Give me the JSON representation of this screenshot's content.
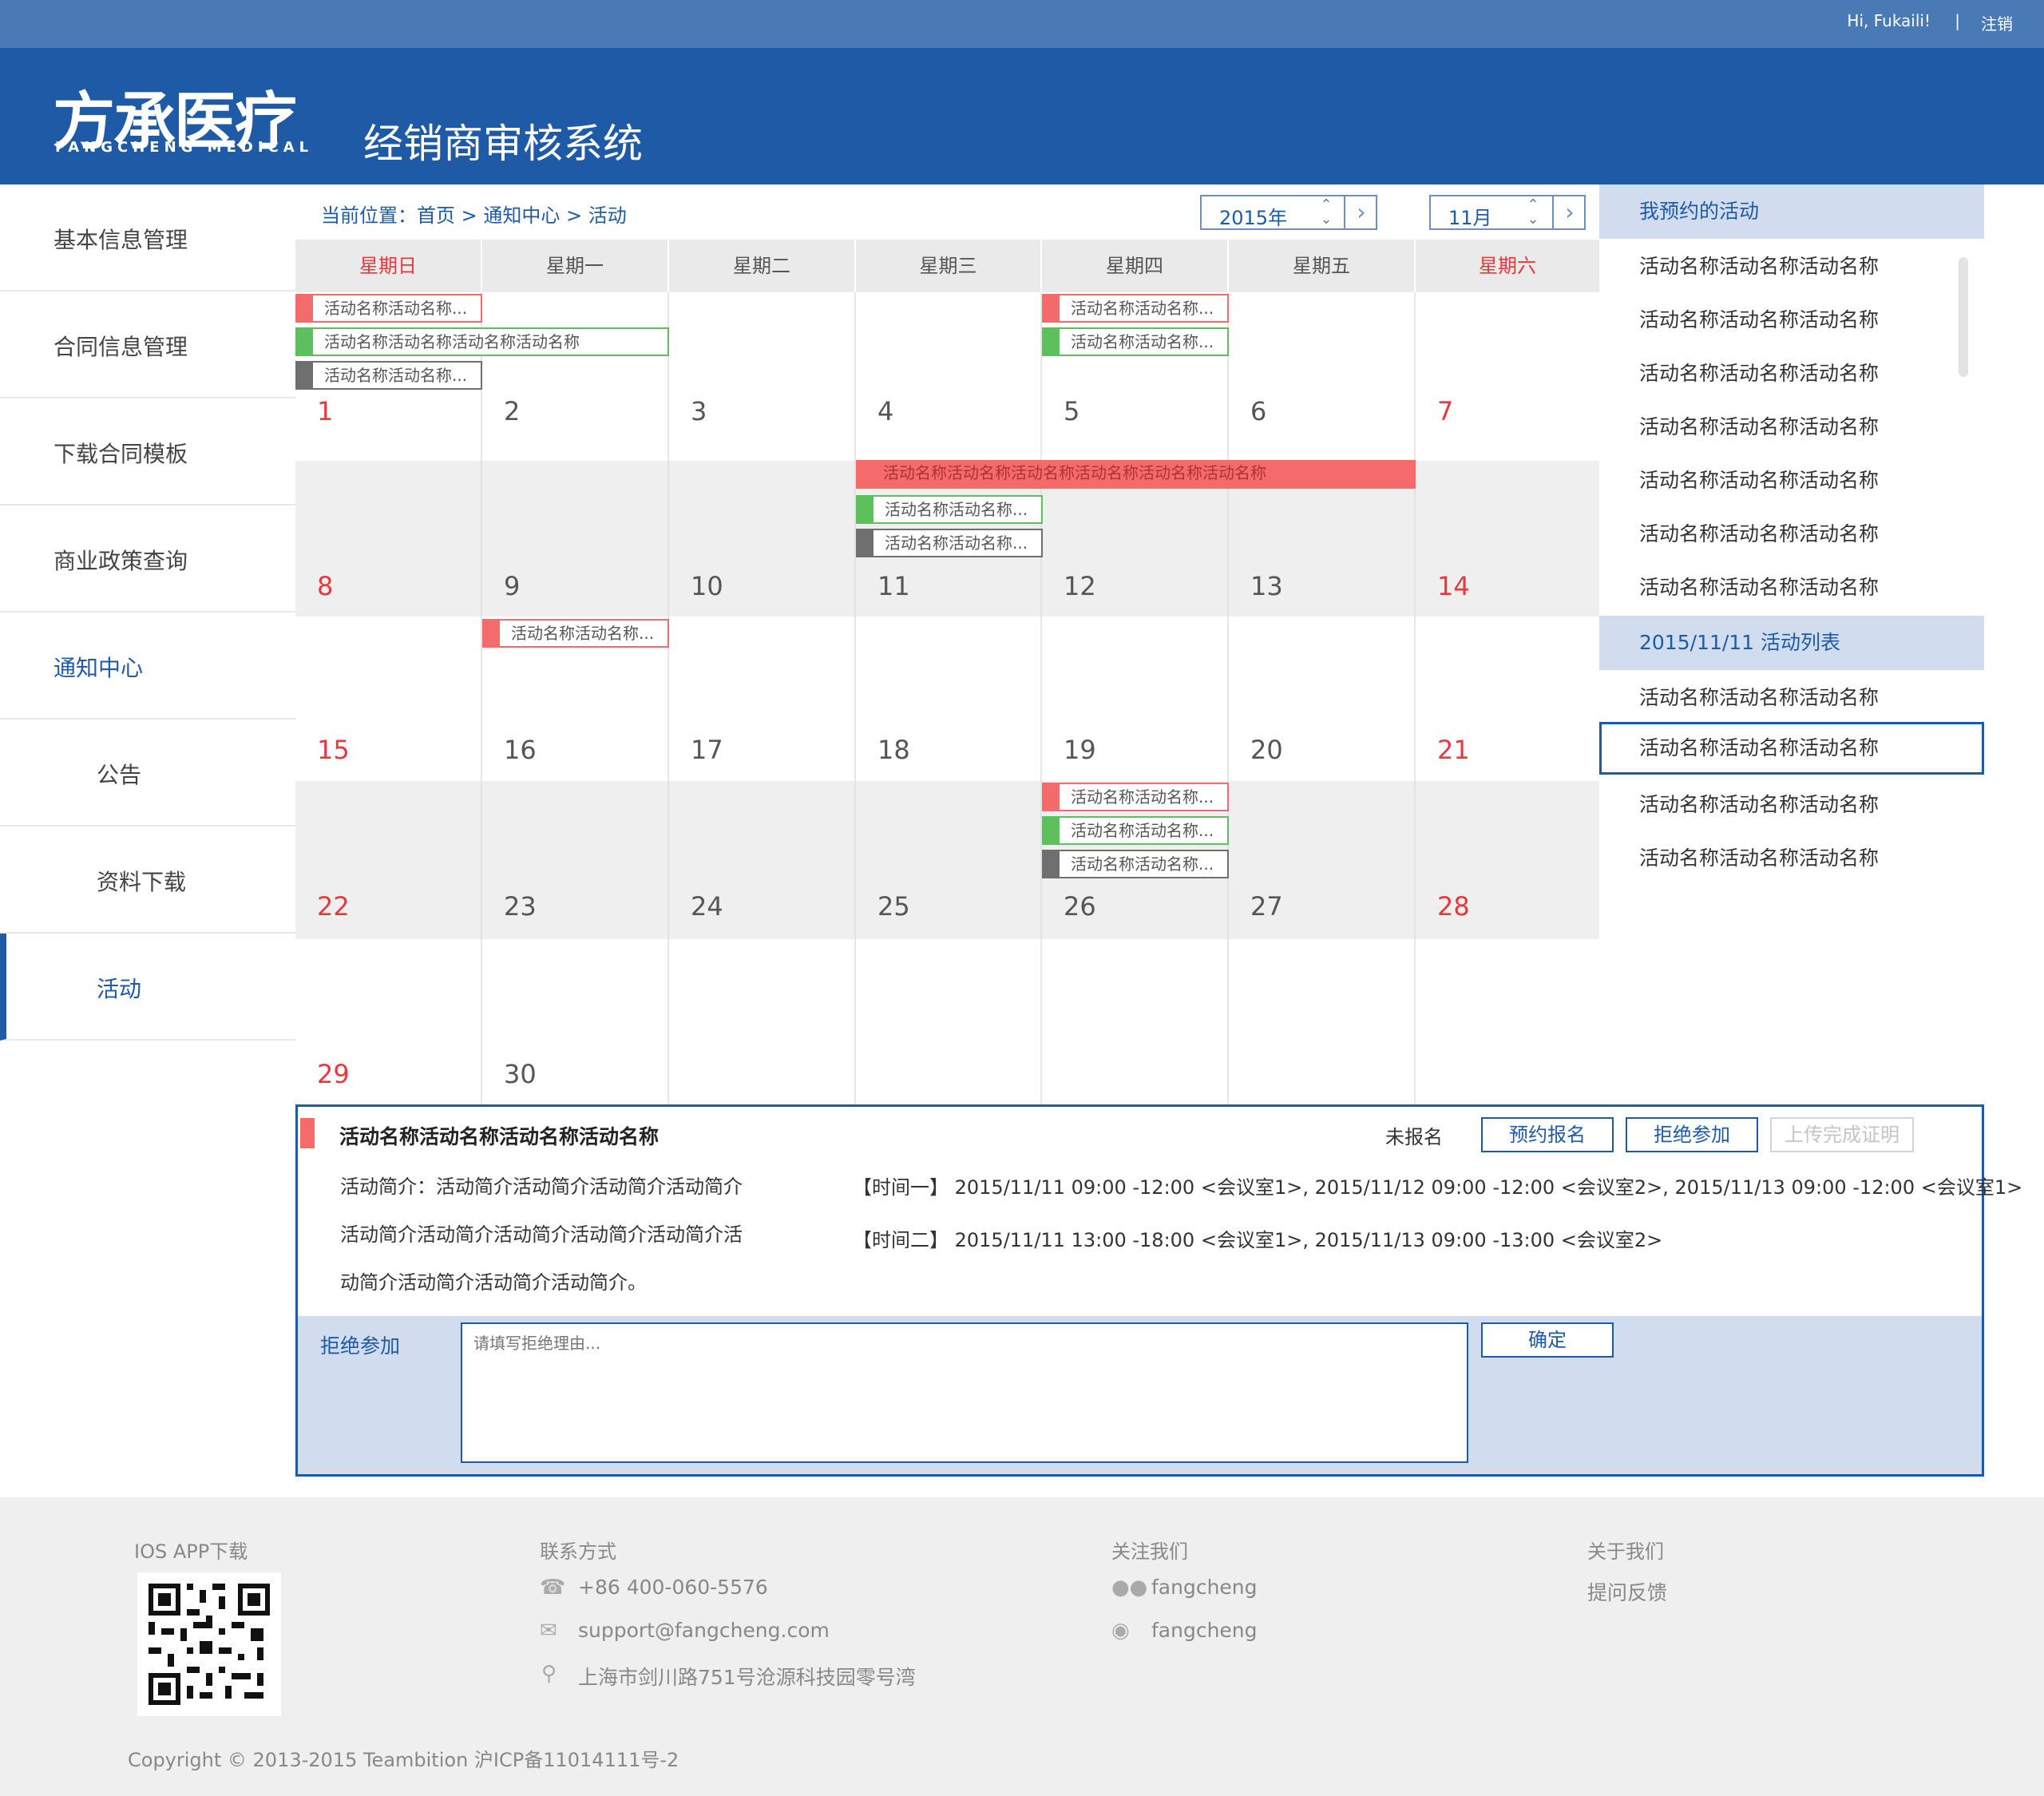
{
  "topbar": {
    "greeting": "Hi, Fukaili!",
    "separator": "|",
    "logout": "注销"
  },
  "header": {
    "logo_text": "方承医疗",
    "logo_sub": "FANGCHENG MEDICAL",
    "system_title": "经销商审核系统"
  },
  "sidebar": {
    "items": [
      {
        "label": "基本信息管理"
      },
      {
        "label": "合同信息管理"
      },
      {
        "label": "下载合同模板"
      },
      {
        "label": "商业政策查询"
      },
      {
        "label": "通知中心"
      },
      {
        "label": "公告"
      },
      {
        "label": "资料下载"
      },
      {
        "label": "活动"
      }
    ]
  },
  "breadcrumb": {
    "text": "当前位置：首页 > 通知中心 > 活动"
  },
  "year_select": {
    "value": "2015年",
    "updown": "⌃\n⌄",
    "next": "›"
  },
  "month_select": {
    "value": "11月",
    "updown": "⌃\n⌄",
    "next": "›"
  },
  "calendar": {
    "weekdays": [
      "星期日",
      "星期一",
      "星期二",
      "星期三",
      "星期四",
      "星期五",
      "星期六"
    ],
    "event_short": "活动名称活动名称...",
    "event_long": "活动名称活动名称活动名称活动名称",
    "event_bar": "活动名称活动名称活动名称活动名称活动名称活动名称",
    "weeks": [
      [
        "1",
        "2",
        "3",
        "4",
        "5",
        "6",
        "7"
      ],
      [
        "8",
        "9",
        "10",
        "11",
        "12",
        "13",
        "14"
      ],
      [
        "15",
        "16",
        "17",
        "18",
        "19",
        "20",
        "21"
      ],
      [
        "22",
        "23",
        "24",
        "25",
        "26",
        "27",
        "28"
      ],
      [
        "29",
        "30",
        "",
        "",
        "",
        "",
        ""
      ]
    ]
  },
  "right_panel": {
    "my_title": "我预约的活动",
    "my_items": [
      "活动名称活动名称活动名称",
      "活动名称活动名称活动名称",
      "活动名称活动名称活动名称",
      "活动名称活动名称活动名称",
      "活动名称活动名称活动名称",
      "活动名称活动名称活动名称",
      "活动名称活动名称活动名称"
    ],
    "day_title": "2015/11/11 活动列表",
    "day_items": [
      "活动名称活动名称活动名称",
      "活动名称活动名称活动名称",
      "活动名称活动名称活动名称",
      "活动名称活动名称活动名称"
    ]
  },
  "detail": {
    "title": "活动名称活动名称活动名称活动名称",
    "status": "未报名",
    "btn_reserve": "预约报名",
    "btn_reject": "拒绝参加",
    "btn_upload": "上传完成证明",
    "intro_lines": [
      "活动简介：活动简介活动简介活动简介活动简介",
      "活动简介活动简介活动简介活动简介活动简介活",
      "动简介活动简介活动简介活动简介。"
    ],
    "time1": "【时间一】 2015/11/11 09:00 -12:00 <会议室1>, 2015/11/12 09:00 -12:00 <会议室2>, 2015/11/13 09:00 -12:00 <会议室1>",
    "time2": "【时间二】 2015/11/11 13:00 -18:00 <会议室1>, 2015/11/13 09:00 -13:00 <会议室2>",
    "reject_label": "拒绝参加",
    "reject_placeholder": "请填写拒绝理由...",
    "confirm": "确定"
  },
  "footer": {
    "ios_title": "IOS APP下载",
    "contact_title": "联系方式",
    "phone": "+86 400-060-5576",
    "email": "support@fangcheng.com",
    "address": "上海市剑川路751号沧源科技园零号湾",
    "follow_title": "关注我们",
    "wechat": "fangcheng",
    "weibo": "fangcheng",
    "about_title": "关于我们",
    "feedback": "提问反馈",
    "copyright": "Copyright © 2013-2015 Teambition 沪ICP备11014111号-2"
  },
  "colors": {
    "brand": "#1e5aa5",
    "topbar": "#4a7ab6",
    "event_red": "#f56b6b",
    "event_green": "#5cc15c",
    "event_gray": "#6f6f6f"
  }
}
